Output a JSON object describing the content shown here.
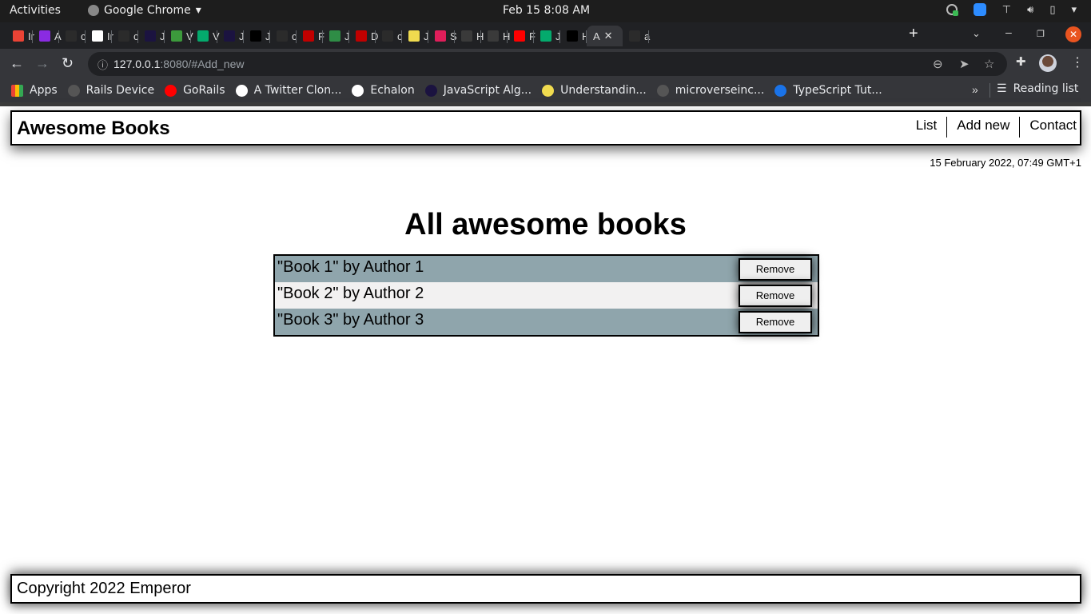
{
  "os_bar": {
    "activities": "Activities",
    "app_name": "Google Chrome",
    "clock": "Feb 15   8:08 AM"
  },
  "browser": {
    "tabs": [
      {
        "initial": "Ir",
        "icon": "gmail-icon",
        "color": "#ea4335"
      },
      {
        "initial": "A",
        "icon": "app-icon",
        "color": "#8a2be2"
      },
      {
        "initial": "c",
        "icon": "github-icon",
        "color": "#2b2b2b"
      },
      {
        "initial": "Ir",
        "icon": "globe-icon",
        "color": "#ffffff"
      },
      {
        "initial": "c",
        "icon": "github-icon",
        "color": "#2b2b2b"
      },
      {
        "initial": "J",
        "icon": "freecodecamp-icon",
        "color": "#1b1340"
      },
      {
        "initial": "V",
        "icon": "nodejs-icon",
        "color": "#3c9a3c"
      },
      {
        "initial": "V",
        "icon": "w3schools-icon",
        "color": "#04aa6d"
      },
      {
        "initial": "J",
        "icon": "freecodecamp-icon",
        "color": "#1b1340"
      },
      {
        "initial": "J",
        "icon": "bird-icon",
        "color": "#000000"
      },
      {
        "initial": "c",
        "icon": "github-icon",
        "color": "#2b2b2b"
      },
      {
        "initial": "F",
        "icon": "tower-icon",
        "color": "#c00000"
      },
      {
        "initial": "J",
        "icon": "geeksforgeeks-icon",
        "color": "#2f8d46"
      },
      {
        "initial": "D",
        "icon": "tower-icon",
        "color": "#c00000"
      },
      {
        "initial": "c",
        "icon": "github-icon",
        "color": "#2b2b2b"
      },
      {
        "initial": "J",
        "icon": "javascript-icon",
        "color": "#f0db4f"
      },
      {
        "initial": "S",
        "icon": "slack-icon",
        "color": "#e01e5a"
      },
      {
        "initial": "H",
        "icon": "hf-icon",
        "color": "#3a3a3a"
      },
      {
        "initial": "H",
        "icon": "hf-icon",
        "color": "#3a3a3a"
      },
      {
        "initial": "F",
        "icon": "youtube-icon",
        "color": "#ff0000"
      },
      {
        "initial": "J",
        "icon": "w3schools-icon",
        "color": "#04aa6d"
      },
      {
        "initial": "H",
        "icon": "bird-icon",
        "color": "#000000"
      },
      {
        "initial": "A",
        "icon": "active-tab",
        "color": "#35363a",
        "active": true
      },
      {
        "initial": "a",
        "icon": "github-icon",
        "color": "#2b2b2b"
      }
    ],
    "url_host": "127.0.0.1",
    "url_rest": ":8080/#Add_new",
    "bookmarks": [
      {
        "label": "Apps",
        "icon": "apps-grid-icon",
        "color": "#ea4335"
      },
      {
        "label": "Rails Device",
        "icon": "github-icon",
        "color": "#555555"
      },
      {
        "label": "GoRails",
        "icon": "youtube-icon",
        "color": "#ff0000"
      },
      {
        "label": "A Twitter Clon...",
        "icon": "shield-icon",
        "color": "#ffffff"
      },
      {
        "label": "Echalon",
        "icon": "globe-icon",
        "color": "#ffffff"
      },
      {
        "label": "JavaScript Alg...",
        "icon": "freecodecamp-icon",
        "color": "#1b1340"
      },
      {
        "label": "Understandin...",
        "icon": "javascript-icon",
        "color": "#f0db4f"
      },
      {
        "label": "microverseinc...",
        "icon": "github-icon",
        "color": "#555555"
      },
      {
        "label": "TypeScript Tut...",
        "icon": "typescript-icon",
        "color": "#1a73e8"
      }
    ],
    "more_bookmarks": "»",
    "reading_list": "Reading list"
  },
  "site": {
    "logo": "Awesome Books",
    "nav": [
      "List",
      "Add new",
      "Contact"
    ],
    "datetime": "15 February 2022, 07:49 GMT+1",
    "heading": "All awesome books",
    "books": [
      {
        "text": "\"Book 1\" by Author 1",
        "button": "Remove"
      },
      {
        "text": "\"Book 2\" by Author 2",
        "button": "Remove"
      },
      {
        "text": "\"Book 3\" by Author 3",
        "button": "Remove"
      }
    ],
    "footer": "Copyright 2022 Emperor",
    "colors": {
      "row_odd": "#8fa5ac",
      "row_even": "#f2f1f1"
    }
  }
}
